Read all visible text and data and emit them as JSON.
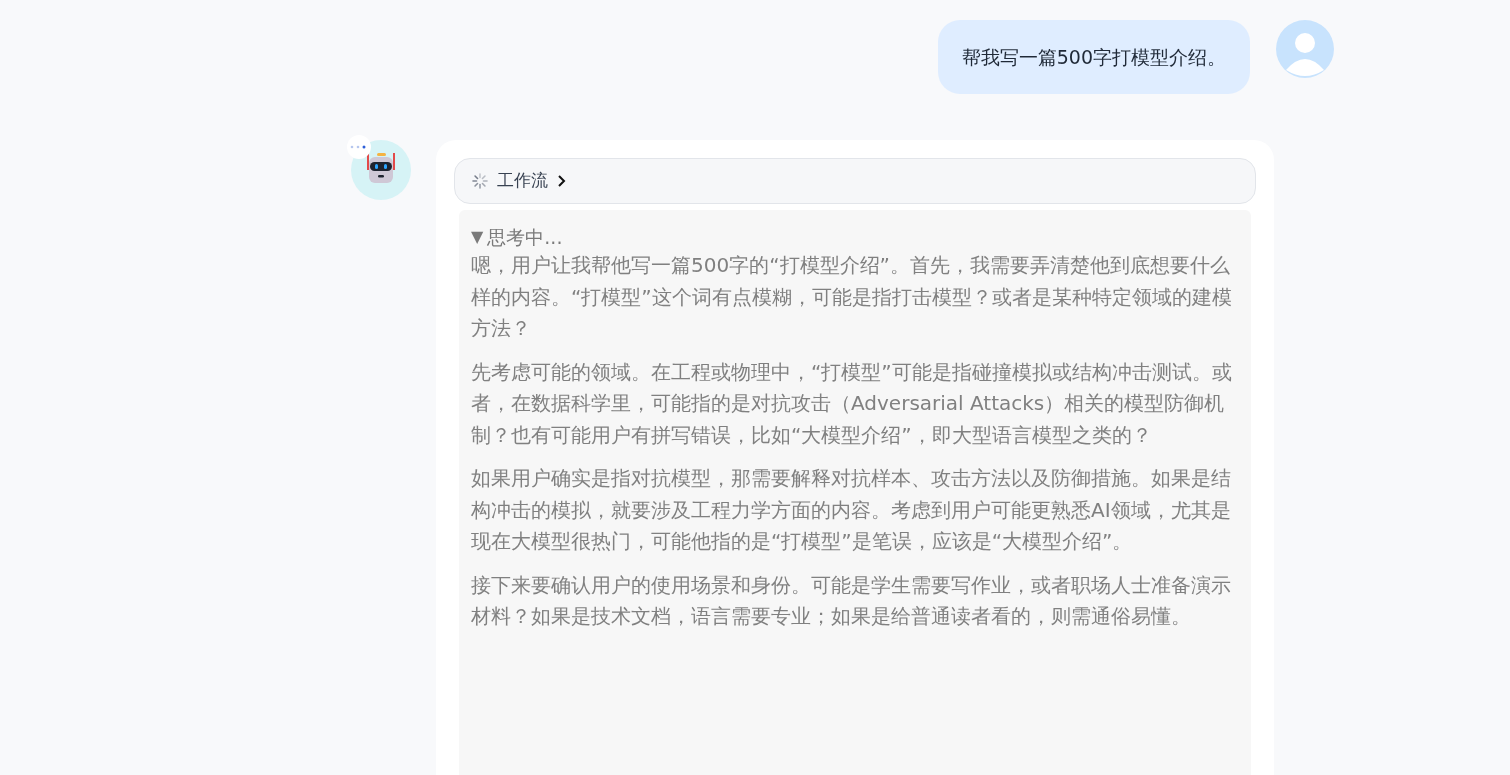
{
  "user_message": {
    "text": "帮我写一篇500字打模型介绍。"
  },
  "assistant": {
    "status_dots": true,
    "workflow": {
      "label": "工作流",
      "running": true
    },
    "thinking": {
      "toggle_icon": "▼",
      "label": "思考中...",
      "expanded": true,
      "paragraphs": [
        "嗯，用户让我帮他写一篇500字的“打模型介绍”。首先，我需要弄清楚他到底想要什么样的内容。“打模型”这个词有点模糊，可能是指打击模型？或者是某种特定领域的建模方法？",
        "先考虑可能的领域。在工程或物理中，“打模型”可能是指碰撞模拟或结构冲击测试。或者，在数据科学里，可能指的是对抗攻击（Adversarial Attacks）相关的模型防御机制？也有可能用户有拼写错误，比如“大模型介绍”，即大型语言模型之类的？",
        "如果用户确实是指对抗模型，那需要解释对抗样本、攻击方法以及防御措施。如果是结构冲击的模拟，就要涉及工程力学方面的内容。考虑到用户可能更熟悉AI领域，尤其是现在大模型很热门，可能他指的是“打模型”是笔误，应该是“大模型介绍”。",
        "接下来要确认用户的使用场景和身份。可能是学生需要写作业，或者职场人士准备演示材料？如果是技术文档，语言需要专业；如果是给普通读者看的，则需通俗易懂。"
      ]
    }
  }
}
